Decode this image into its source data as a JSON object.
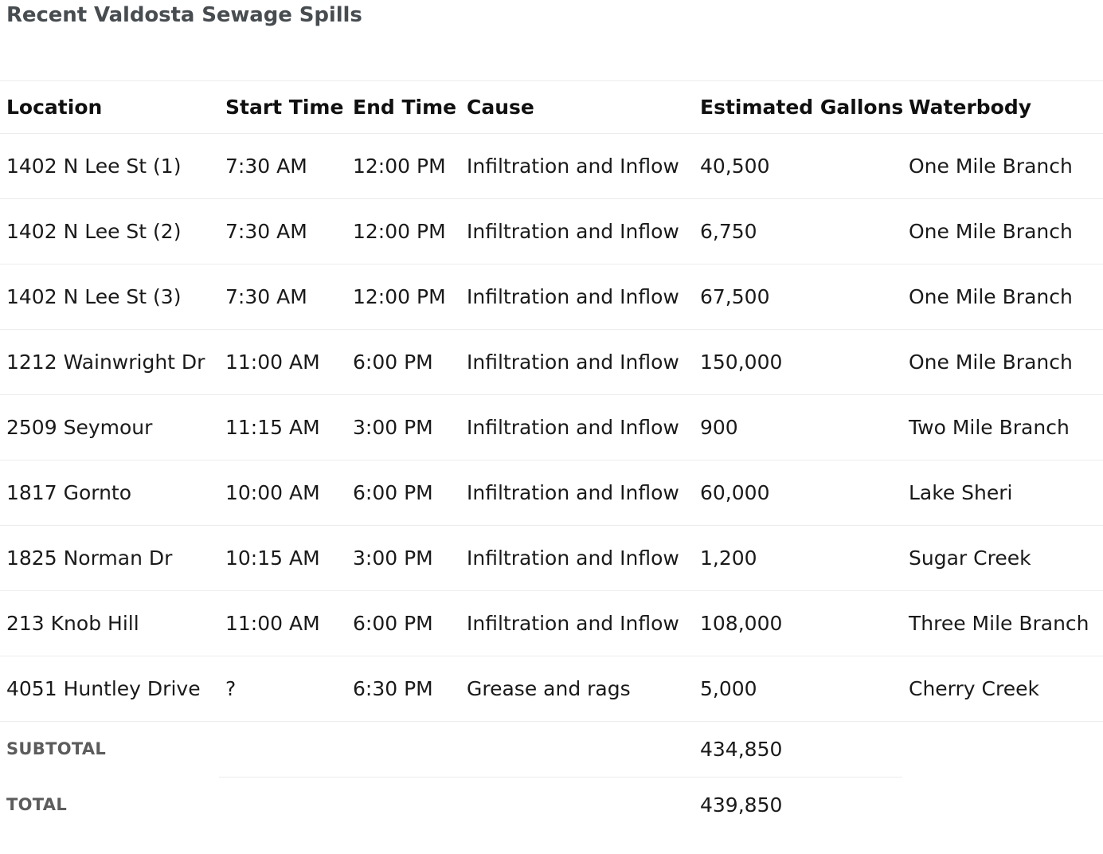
{
  "page": {
    "title": "Recent Valdosta Sewage Spills"
  },
  "table": {
    "columns": [
      {
        "key": "location",
        "label": "Location"
      },
      {
        "key": "start_time",
        "label": "Start Time"
      },
      {
        "key": "end_time",
        "label": "End Time"
      },
      {
        "key": "cause",
        "label": "Cause"
      },
      {
        "key": "estimated_gallons",
        "label": "Estimated Gallons"
      },
      {
        "key": "waterbody",
        "label": "Waterbody"
      }
    ],
    "rows": [
      {
        "location": "1402 N Lee St (1)",
        "start_time": "7:30 AM",
        "end_time": "12:00 PM",
        "cause": "Infiltration and Inflow",
        "estimated_gallons": "40,500",
        "waterbody": "One Mile Branch"
      },
      {
        "location": "1402 N Lee St (2)",
        "start_time": "7:30 AM",
        "end_time": "12:00 PM",
        "cause": "Infiltration and Inflow",
        "estimated_gallons": "6,750",
        "waterbody": "One Mile Branch"
      },
      {
        "location": "1402 N Lee St (3)",
        "start_time": "7:30 AM",
        "end_time": "12:00 PM",
        "cause": "Infiltration and Inflow",
        "estimated_gallons": "67,500",
        "waterbody": "One Mile Branch"
      },
      {
        "location": "1212 Wainwright Dr",
        "start_time": "11:00 AM",
        "end_time": "6:00 PM",
        "cause": "Infiltration and Inflow",
        "estimated_gallons": "150,000",
        "waterbody": "One Mile Branch"
      },
      {
        "location": "2509 Seymour",
        "start_time": "11:15 AM",
        "end_time": "3:00 PM",
        "cause": "Infiltration and Inflow",
        "estimated_gallons": "900",
        "waterbody": "Two Mile Branch"
      },
      {
        "location": "1817 Gornto",
        "start_time": "10:00 AM",
        "end_time": "6:00 PM",
        "cause": "Infiltration and Inflow",
        "estimated_gallons": "60,000",
        "waterbody": "Lake Sheri"
      },
      {
        "location": "1825 Norman Dr",
        "start_time": "10:15 AM",
        "end_time": "3:00 PM",
        "cause": "Infiltration and Inflow",
        "estimated_gallons": "1,200",
        "waterbody": "Sugar Creek"
      },
      {
        "location": "213 Knob Hill",
        "start_time": "11:00 AM",
        "end_time": "6:00 PM",
        "cause": "Infiltration and Inflow",
        "estimated_gallons": "108,000",
        "waterbody": "Three Mile Branch"
      },
      {
        "location": "4051 Huntley Drive",
        "start_time": "?",
        "end_time": "6:30 PM",
        "cause": "Grease and rags",
        "estimated_gallons": "5,000",
        "waterbody": "Cherry Creek"
      }
    ],
    "summary": [
      {
        "label": "SUBTOTAL",
        "start_time": "",
        "end_time": "",
        "cause": "",
        "estimated_gallons": "434,850",
        "waterbody": ""
      },
      {
        "label": "TOTAL",
        "start_time": "",
        "end_time": "",
        "cause": "",
        "estimated_gallons": "439,850",
        "waterbody": ""
      }
    ]
  },
  "colors": {
    "title": "#474c50",
    "header_text": "#101010",
    "body_text": "#1a1a1a",
    "summary_label": "#5c5c5c",
    "rule": "#ececec",
    "background": "#ffffff"
  }
}
